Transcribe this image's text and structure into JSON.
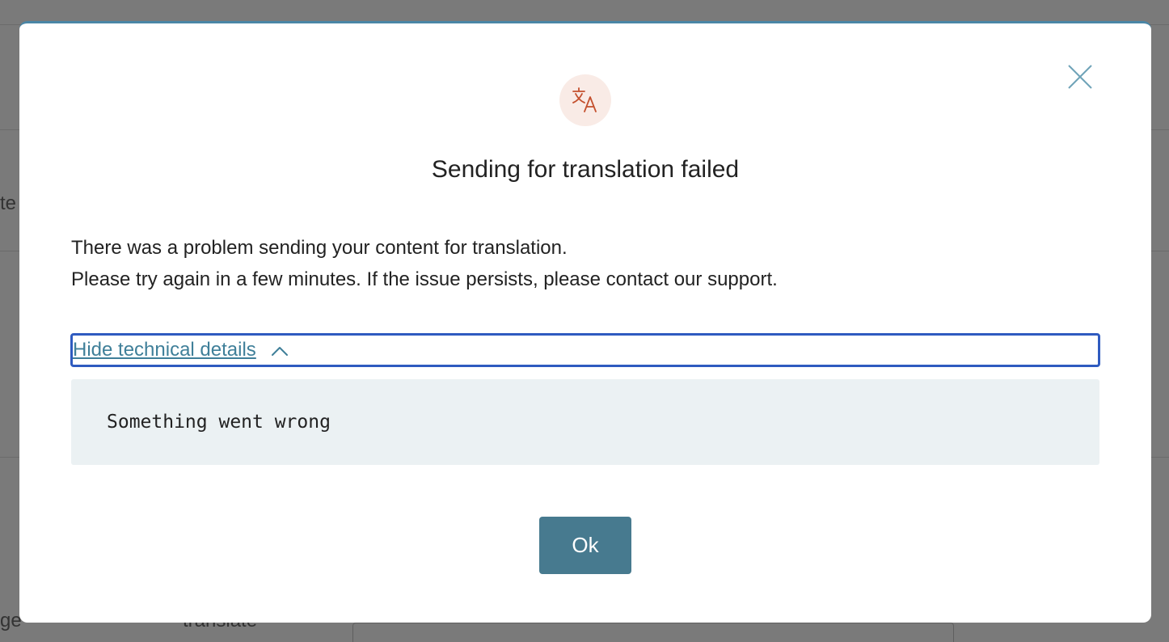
{
  "background": {
    "fragment_left_top": "te",
    "fragment_left_bottom": "ge",
    "fragment_bottom": "translate"
  },
  "dialog": {
    "icon": "translate-icon",
    "title": "Sending for translation failed",
    "message_line_1": "There was a problem sending your content for translation.",
    "message_line_2": "Please try again in a few minutes. If the issue persists, please contact our support.",
    "details_toggle_label": "Hide technical details",
    "details_text": "Something went wrong",
    "ok_label": "Ok",
    "close_icon": "close-icon"
  },
  "colors": {
    "accent": "#477a8f",
    "link": "#3f7f99",
    "focus_ring": "#2f5bc0",
    "icon_badge_bg": "#f9ebe6",
    "icon_color": "#c4502e",
    "details_bg": "#ebf1f3"
  }
}
